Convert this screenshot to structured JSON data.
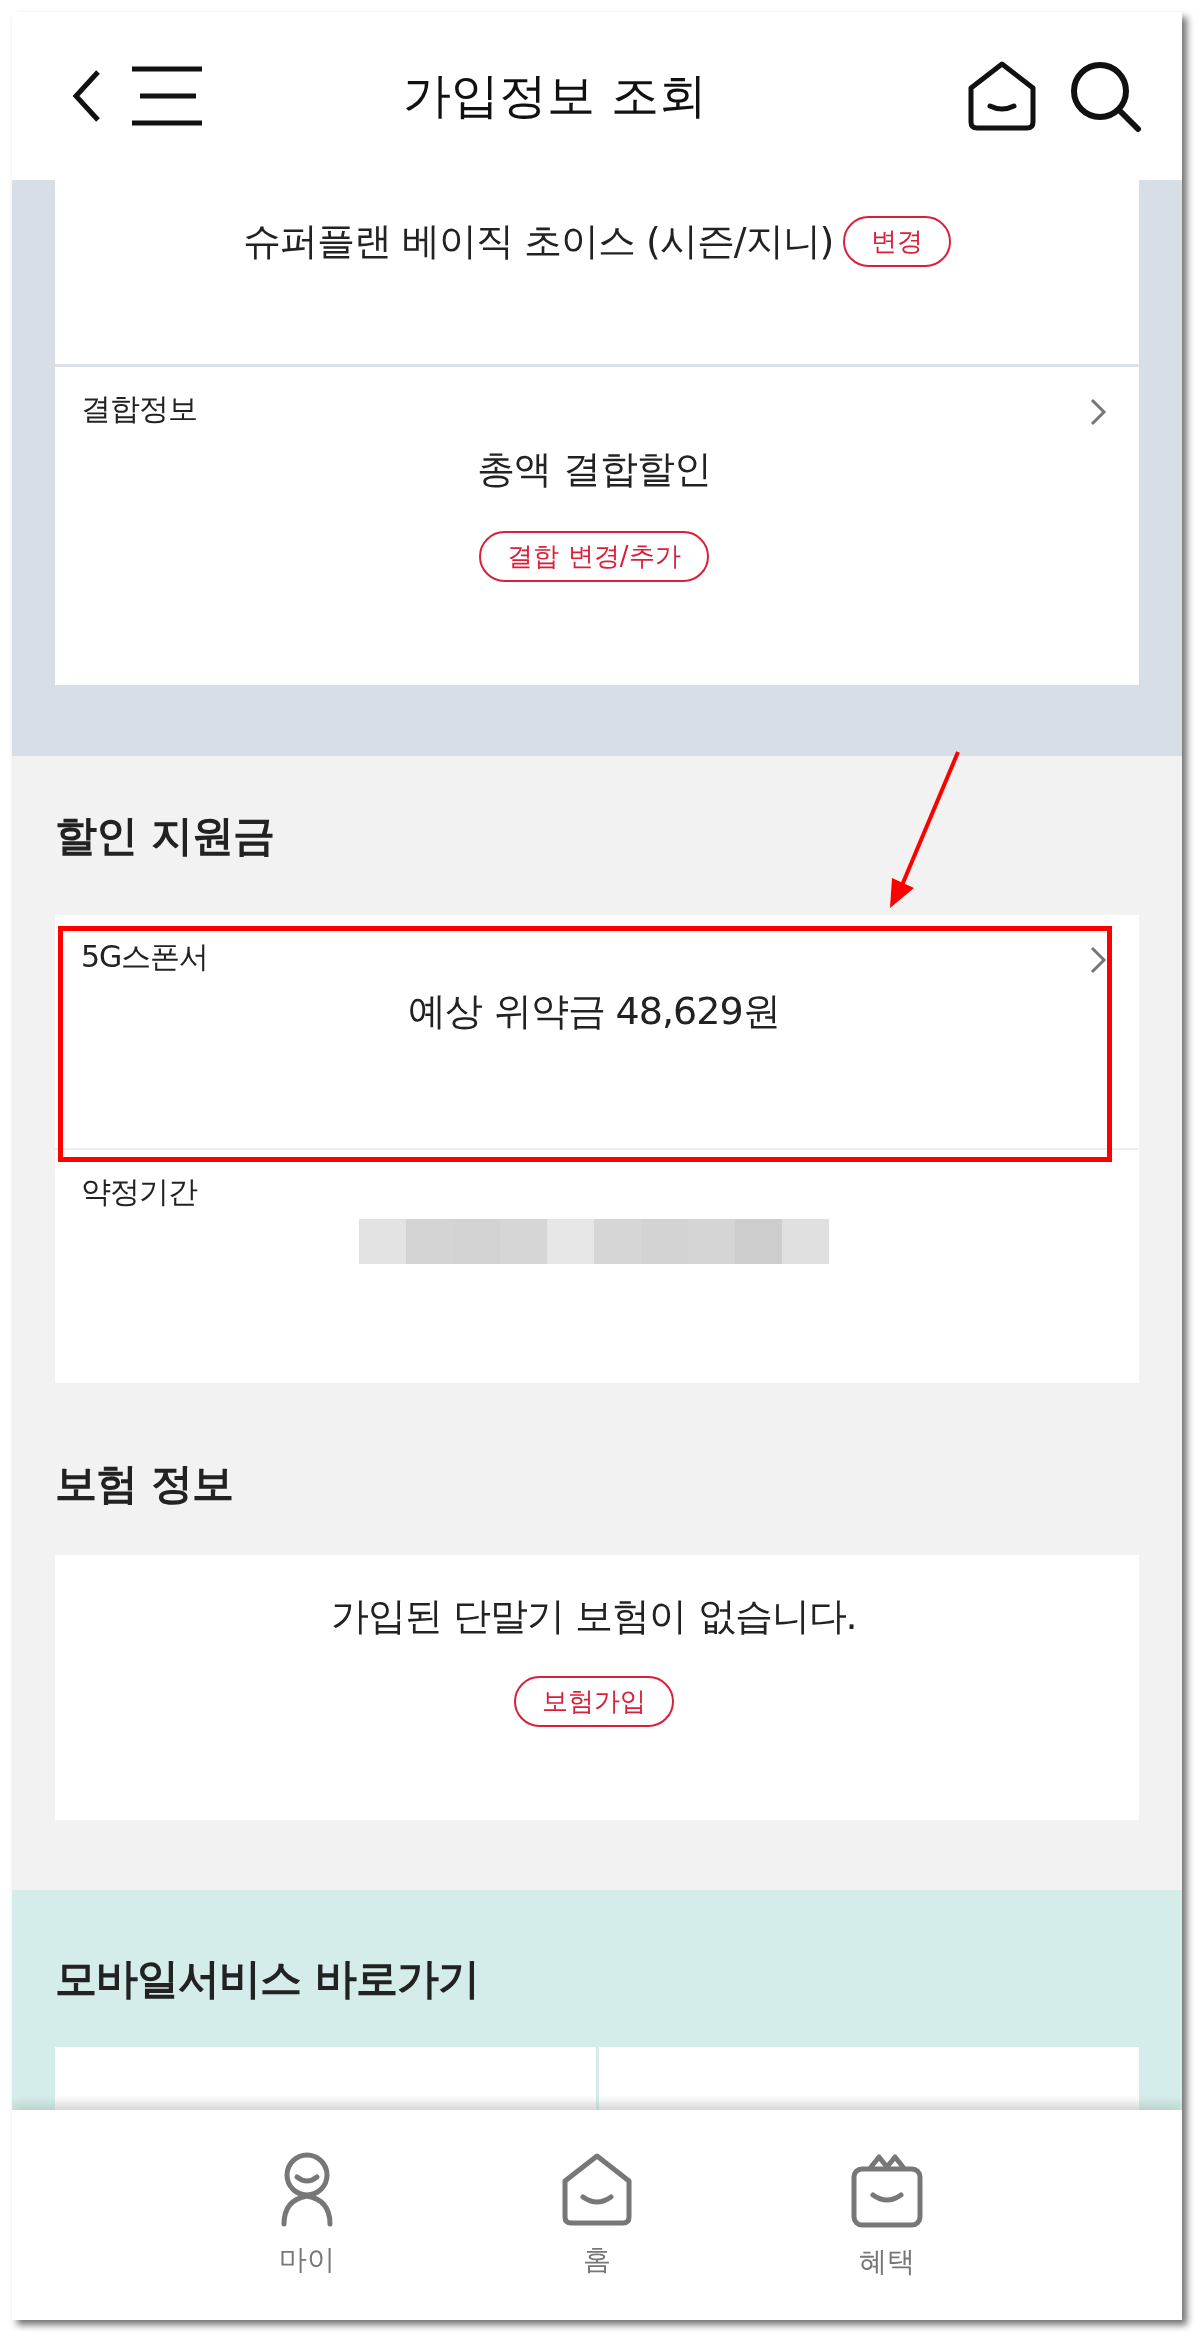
{
  "header": {
    "title": "가입정보 조회"
  },
  "plan_card": {
    "plan": "슈퍼플랜 베이직 초이스 (시즌/지니)",
    "change_button": "변경",
    "combination": {
      "label": "결합정보",
      "value": "총액 결합할인",
      "button": "결합 변경/추가"
    }
  },
  "discount": {
    "heading": "할인 지원금",
    "sponsor": {
      "label": "5G스폰서",
      "value": "예상 위약금 48,629원"
    },
    "contract": {
      "label": "약정기간"
    }
  },
  "insurance": {
    "heading": "보험 정보",
    "message": "가입된 단말기 보험이 없습니다.",
    "button": "보험가입"
  },
  "mobile_services": {
    "heading": "모바일서비스 바로가기"
  },
  "bottom_nav": [
    {
      "label": "마이",
      "kind": "my"
    },
    {
      "label": "홈",
      "kind": "home"
    },
    {
      "label": "혜택",
      "kind": "benefit"
    }
  ]
}
